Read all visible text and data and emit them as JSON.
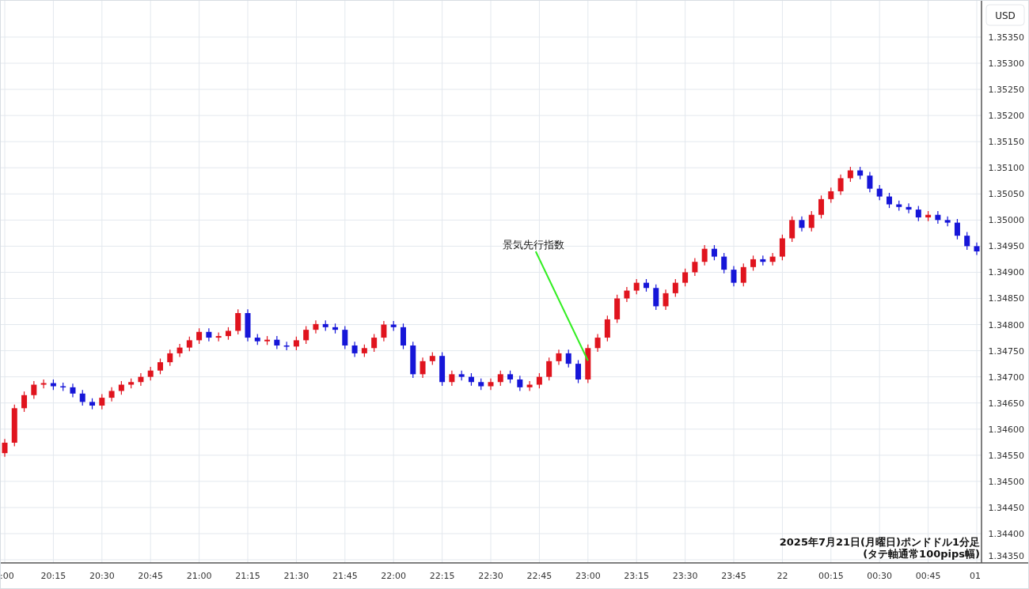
{
  "currency_label": "USD",
  "caption_lines": [
    "2025年7月21日(月曜日)ポンドドル1分足",
    "(タテ軸通常100pips幅)"
  ],
  "chart_data": {
    "type": "candlestick",
    "grid": true,
    "ylim": [
      1.34344,
      1.35421
    ],
    "yticks": [
      {
        "value": 1.3435,
        "label": "1.34350"
      },
      {
        "value": 1.344,
        "label": "1.34400"
      },
      {
        "value": 1.3445,
        "label": "1.34450"
      },
      {
        "value": 1.345,
        "label": "1.34500"
      },
      {
        "value": 1.3455,
        "label": "1.34550"
      },
      {
        "value": 1.346,
        "label": "1.34600"
      },
      {
        "value": 1.3465,
        "label": "1.34650"
      },
      {
        "value": 1.347,
        "label": "1.34700"
      },
      {
        "value": 1.3475,
        "label": "1.34750"
      },
      {
        "value": 1.348,
        "label": "1.34800"
      },
      {
        "value": 1.3485,
        "label": "1.34850"
      },
      {
        "value": 1.349,
        "label": "1.34900"
      },
      {
        "value": 1.3495,
        "label": "1.34950"
      },
      {
        "value": 1.35,
        "label": "1.35000"
      },
      {
        "value": 1.3505,
        "label": "1.35050"
      },
      {
        "value": 1.351,
        "label": "1.35100"
      },
      {
        "value": 1.3515,
        "label": "1.35150"
      },
      {
        "value": 1.352,
        "label": "1.35200"
      },
      {
        "value": 1.3525,
        "label": "1.35250"
      },
      {
        "value": 1.353,
        "label": "1.35300"
      },
      {
        "value": 1.3535,
        "label": "1.35350"
      }
    ],
    "categories": [
      ":00",
      null,
      null,
      null,
      null,
      "20:15",
      null,
      null,
      null,
      null,
      "20:30",
      null,
      null,
      null,
      null,
      "20:45",
      null,
      null,
      null,
      null,
      "21:00",
      null,
      null,
      null,
      null,
      "21:15",
      null,
      null,
      null,
      null,
      "21:30",
      null,
      null,
      null,
      null,
      "21:45",
      null,
      null,
      null,
      null,
      "22:00",
      null,
      null,
      null,
      null,
      "22:15",
      null,
      null,
      null,
      null,
      "22:30",
      null,
      null,
      null,
      null,
      "22:45",
      null,
      null,
      null,
      null,
      "23:00",
      null,
      null,
      null,
      null,
      "23:15",
      null,
      null,
      null,
      null,
      "23:30",
      null,
      null,
      null,
      null,
      "23:45",
      null,
      null,
      null,
      null,
      "22",
      null,
      null,
      null,
      null,
      "00:15",
      null,
      null,
      null,
      null,
      "00:30",
      null,
      null,
      null,
      null,
      "00:45",
      null,
      null,
      null,
      null,
      "01"
    ],
    "ohlc": [
      [
        1.34554,
        1.34581,
        1.34547,
        1.34574
      ],
      [
        1.34574,
        1.34647,
        1.34567,
        1.3464
      ],
      [
        1.3464,
        1.34672,
        1.34633,
        1.34665
      ],
      [
        1.34665,
        1.34692,
        1.34658,
        1.34685
      ],
      [
        1.34685,
        1.34695,
        1.34678,
        1.34688
      ],
      [
        1.34688,
        1.34695,
        1.34675,
        1.34682
      ],
      [
        1.34682,
        1.34689,
        1.34673,
        1.3468
      ],
      [
        1.3468,
        1.34687,
        1.34661,
        1.34668
      ],
      [
        1.34668,
        1.34675,
        1.34645,
        1.34652
      ],
      [
        1.34652,
        1.34659,
        1.34638,
        1.34645
      ],
      [
        1.34645,
        1.34667,
        1.34638,
        1.3466
      ],
      [
        1.3466,
        1.3468,
        1.34653,
        1.34673
      ],
      [
        1.34673,
        1.34692,
        1.34666,
        1.34685
      ],
      [
        1.34685,
        1.34697,
        1.34678,
        1.3469
      ],
      [
        1.3469,
        1.34707,
        1.34683,
        1.347
      ],
      [
        1.347,
        1.34719,
        1.34693,
        1.34712
      ],
      [
        1.34712,
        1.34735,
        1.34705,
        1.34728
      ],
      [
        1.34728,
        1.34752,
        1.34721,
        1.34745
      ],
      [
        1.34745,
        1.34763,
        1.34738,
        1.34756
      ],
      [
        1.34756,
        1.34777,
        1.34749,
        1.3477
      ],
      [
        1.3477,
        1.34793,
        1.34763,
        1.34786
      ],
      [
        1.34786,
        1.34793,
        1.34768,
        1.34775
      ],
      [
        1.34775,
        1.34785,
        1.34768,
        1.34778
      ],
      [
        1.34778,
        1.34795,
        1.34771,
        1.34788
      ],
      [
        1.34788,
        1.34829,
        1.34781,
        1.34822
      ],
      [
        1.34822,
        1.34829,
        1.34768,
        1.34775
      ],
      [
        1.34775,
        1.34782,
        1.34761,
        1.34768
      ],
      [
        1.34768,
        1.34778,
        1.34761,
        1.34771
      ],
      [
        1.34771,
        1.34778,
        1.34753,
        1.3476
      ],
      [
        1.3476,
        1.34767,
        1.34751,
        1.34758
      ],
      [
        1.34758,
        1.34777,
        1.34751,
        1.3477
      ],
      [
        1.3477,
        1.34797,
        1.34763,
        1.3479
      ],
      [
        1.3479,
        1.34808,
        1.34783,
        1.34801
      ],
      [
        1.34801,
        1.34808,
        1.34788,
        1.34795
      ],
      [
        1.34795,
        1.34802,
        1.34783,
        1.3479
      ],
      [
        1.3479,
        1.34797,
        1.34753,
        1.3476
      ],
      [
        1.3476,
        1.34767,
        1.34738,
        1.34745
      ],
      [
        1.34745,
        1.34762,
        1.34738,
        1.34755
      ],
      [
        1.34755,
        1.34782,
        1.34748,
        1.34775
      ],
      [
        1.34775,
        1.34807,
        1.34768,
        1.348
      ],
      [
        1.348,
        1.34807,
        1.34788,
        1.34795
      ],
      [
        1.34795,
        1.34802,
        1.34753,
        1.3476
      ],
      [
        1.3476,
        1.34767,
        1.34698,
        1.34705
      ],
      [
        1.34705,
        1.34737,
        1.34698,
        1.3473
      ],
      [
        1.3473,
        1.34747,
        1.34723,
        1.3474
      ],
      [
        1.3474,
        1.34747,
        1.34683,
        1.3469
      ],
      [
        1.3469,
        1.34712,
        1.34683,
        1.34705
      ],
      [
        1.34705,
        1.34712,
        1.34693,
        1.347
      ],
      [
        1.347,
        1.34707,
        1.34683,
        1.3469
      ],
      [
        1.3469,
        1.34697,
        1.34675,
        1.34682
      ],
      [
        1.34682,
        1.34697,
        1.34675,
        1.3469
      ],
      [
        1.3469,
        1.34712,
        1.34683,
        1.34705
      ],
      [
        1.34705,
        1.34712,
        1.34688,
        1.34695
      ],
      [
        1.34695,
        1.34702,
        1.34673,
        1.3468
      ],
      [
        1.3468,
        1.34692,
        1.34673,
        1.34685
      ],
      [
        1.34685,
        1.34707,
        1.34678,
        1.347
      ],
      [
        1.347,
        1.34737,
        1.34693,
        1.3473
      ],
      [
        1.3473,
        1.34752,
        1.34723,
        1.34745
      ],
      [
        1.34745,
        1.34752,
        1.34718,
        1.34725
      ],
      [
        1.34725,
        1.34732,
        1.34688,
        1.34695
      ],
      [
        1.34695,
        1.34762,
        1.34688,
        1.34755
      ],
      [
        1.34755,
        1.34782,
        1.34748,
        1.34775
      ],
      [
        1.34775,
        1.34817,
        1.34768,
        1.3481
      ],
      [
        1.3481,
        1.34857,
        1.34803,
        1.3485
      ],
      [
        1.3485,
        1.34872,
        1.34843,
        1.34865
      ],
      [
        1.34865,
        1.34887,
        1.34858,
        1.3488
      ],
      [
        1.3488,
        1.34887,
        1.34863,
        1.3487
      ],
      [
        1.3487,
        1.34877,
        1.34828,
        1.34835
      ],
      [
        1.34835,
        1.34867,
        1.34828,
        1.3486
      ],
      [
        1.3486,
        1.34887,
        1.34853,
        1.3488
      ],
      [
        1.3488,
        1.34907,
        1.34873,
        1.349
      ],
      [
        1.349,
        1.34927,
        1.34893,
        1.3492
      ],
      [
        1.3492,
        1.34952,
        1.34913,
        1.34945
      ],
      [
        1.34945,
        1.34952,
        1.34923,
        1.3493
      ],
      [
        1.3493,
        1.34937,
        1.34898,
        1.34905
      ],
      [
        1.34905,
        1.34912,
        1.34873,
        1.3488
      ],
      [
        1.3488,
        1.34917,
        1.34873,
        1.3491
      ],
      [
        1.3491,
        1.34932,
        1.34903,
        1.34925
      ],
      [
        1.34925,
        1.34932,
        1.34913,
        1.3492
      ],
      [
        1.3492,
        1.34937,
        1.34913,
        1.3493
      ],
      [
        1.3493,
        1.34972,
        1.34923,
        1.34965
      ],
      [
        1.34965,
        1.35007,
        1.34958,
        1.35
      ],
      [
        1.35,
        1.35007,
        1.34978,
        1.34985
      ],
      [
        1.34985,
        1.35017,
        1.34978,
        1.3501
      ],
      [
        1.3501,
        1.35047,
        1.35003,
        1.3504
      ],
      [
        1.3504,
        1.35062,
        1.35033,
        1.35055
      ],
      [
        1.35055,
        1.35087,
        1.35048,
        1.3508
      ],
      [
        1.3508,
        1.35102,
        1.35073,
        1.35095
      ],
      [
        1.35095,
        1.35102,
        1.35078,
        1.35085
      ],
      [
        1.35085,
        1.35092,
        1.35053,
        1.3506
      ],
      [
        1.3506,
        1.35067,
        1.35038,
        1.35045
      ],
      [
        1.35045,
        1.35052,
        1.35023,
        1.3503
      ],
      [
        1.3503,
        1.35037,
        1.35018,
        1.35025
      ],
      [
        1.35025,
        1.35032,
        1.35013,
        1.3502
      ],
      [
        1.3502,
        1.35027,
        1.34998,
        1.35005
      ],
      [
        1.35005,
        1.35017,
        1.34998,
        1.3501
      ],
      [
        1.3501,
        1.35017,
        1.34993,
        1.35
      ],
      [
        1.35,
        1.35007,
        1.34988,
        1.34995
      ],
      [
        1.34995,
        1.35002,
        1.34963,
        1.3497
      ],
      [
        1.3497,
        1.34977,
        1.34943,
        1.3495
      ],
      [
        1.3495,
        1.34957,
        1.34933,
        1.3494
      ]
    ],
    "annotations": [
      "景気先行指数"
    ]
  }
}
